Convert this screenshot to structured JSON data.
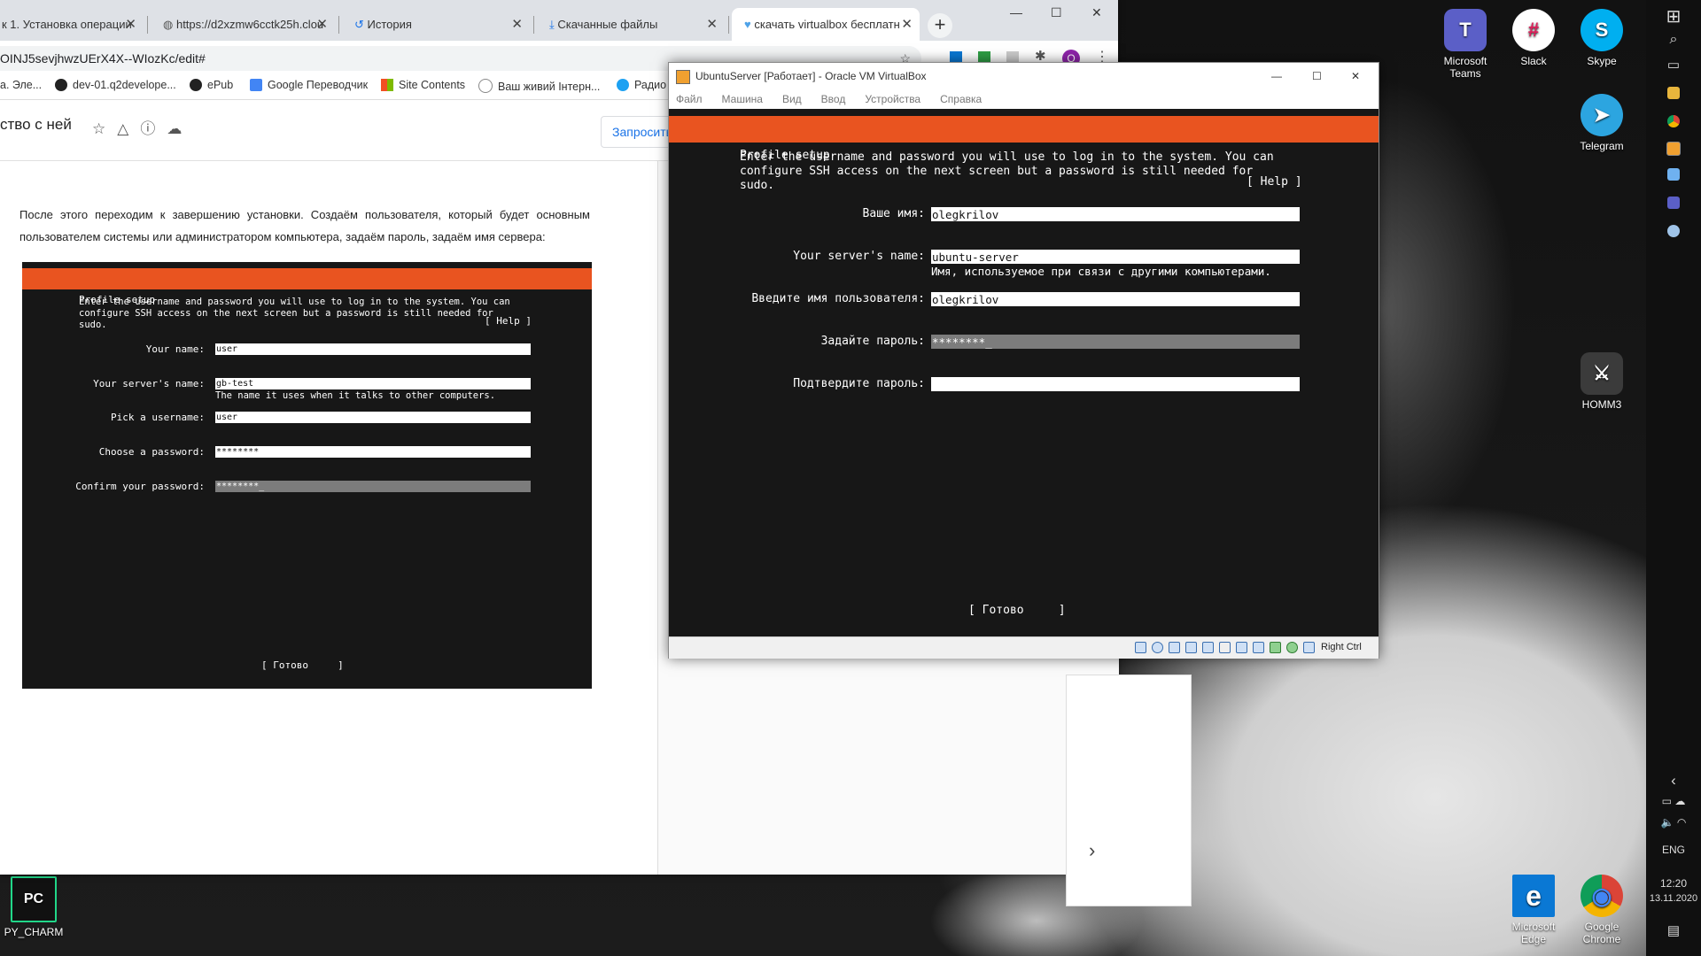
{
  "browser": {
    "tabs": [
      {
        "title": "к 1. Установка операции"
      },
      {
        "title": "https://d2xzmw6cctk25h.clou"
      },
      {
        "title": "История"
      },
      {
        "title": "Скачанные файлы"
      },
      {
        "title": "скачать virtualbox бесплатн"
      }
    ],
    "new_tab": "+",
    "window_min": "—",
    "window_max": "☐",
    "window_close": "✕",
    "url": "OINJ5sevjhwzUErX4X--WIozKc/edit#",
    "bookmarks": [
      {
        "label": "а. Эле..."
      },
      {
        "label": "dev-01.q2develope..."
      },
      {
        "label": "ePub"
      },
      {
        "label": "Google Переводчик"
      },
      {
        "label": "Site Contents"
      },
      {
        "label": "Ваш живий Інтерн..."
      },
      {
        "label": "Радио"
      }
    ],
    "avatar_letter": "O"
  },
  "doc": {
    "title": "ство с ней",
    "request_button": "Запросить",
    "paragraph": "После этого переходим к завершению установки. Создаём пользователя, который будет основным пользователем системы или администратором компьютера, задаём пароль, задаём имя сервера:",
    "next_arrow": "›"
  },
  "doc_screenshot": {
    "header": "Profile setup",
    "help": "[ Help ]",
    "intro": "Enter the username and password you will use to log in to the system. You can\nconfigure SSH access on the next screen but a password is still needed for\nsudo.",
    "fields": [
      {
        "label": "Your name:",
        "value": "user"
      },
      {
        "label": "Your server's name:",
        "value": "gb-test"
      },
      {
        "label": "Pick a username:",
        "value": "user"
      },
      {
        "label": "Choose a password:",
        "value": "********"
      },
      {
        "label": "Confirm your password:",
        "value": "********_"
      }
    ],
    "server_hint": "The name it uses when it talks to other computers.",
    "done_button": "[ Готово     ]"
  },
  "virtualbox": {
    "window_title": "UbuntuServer [Работает] - Oracle VM VirtualBox",
    "menu": [
      "Файл",
      "Машина",
      "Вид",
      "Ввод",
      "Устройства",
      "Справка"
    ],
    "window_min": "—",
    "window_max": "☐",
    "window_close": "✕",
    "host_key": "Right Ctrl",
    "screen": {
      "header": "Profile setup",
      "help": "[ Help ]",
      "intro": "Enter the username and password you will use to log in to the system. You can\nconfigure SSH access on the next screen but a password is still needed for\nsudo.",
      "fields": [
        {
          "label": "Ваше имя:",
          "value": "olegkrilov"
        },
        {
          "label": "Your server's name:",
          "value": "ubuntu-server"
        },
        {
          "label": "Введите имя пользователя:",
          "value": "olegkrilov"
        },
        {
          "label": "Задайте пароль:",
          "value": "********_"
        },
        {
          "label": "Подтвердите пароль:",
          "value": ""
        }
      ],
      "server_hint": "Имя, используемое при связи с другими компьютерами.",
      "done_button": "[ Готово     ]"
    }
  },
  "desktop": {
    "icons": [
      {
        "label": "Microsoft Teams",
        "glyph": "T",
        "color": "#5b5fc7"
      },
      {
        "label": "Slack",
        "glyph": "#",
        "color": "#4a154b"
      },
      {
        "label": "Skype",
        "glyph": "S",
        "color": "#00aff0"
      },
      {
        "label": "Telegram",
        "glyph": "➤",
        "color": "#2ca5e0"
      },
      {
        "label": "HOMM3",
        "glyph": "⚔",
        "color": "#3b3b3b"
      },
      {
        "label": "PY_CHARM",
        "glyph": "PC",
        "color": "#1b1b1b"
      },
      {
        "label": "Microsoft Edge",
        "glyph": "e",
        "color": "#0a78d4"
      },
      {
        "label": "Google Chrome",
        "glyph": "◉",
        "color": "#db4437"
      }
    ]
  },
  "taskbar": {
    "language": "ENG",
    "time": "12:20",
    "date": "13.11.2020"
  },
  "colors": {
    "ubuntu_orange": "#e95420",
    "terminal_bg": "#171717",
    "chrome_tabstrip": "#dee1e6"
  }
}
